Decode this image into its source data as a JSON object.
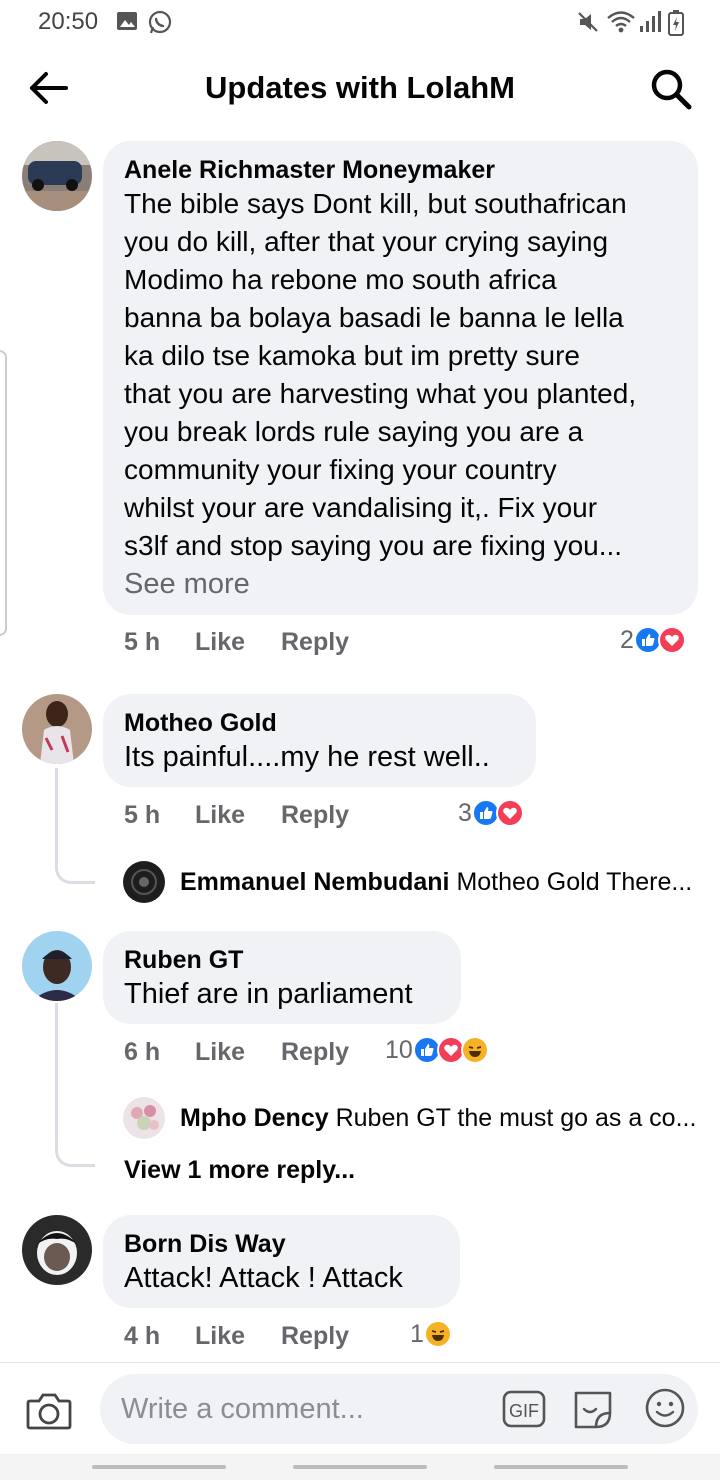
{
  "status_bar": {
    "time": "20:50"
  },
  "header": {
    "title": "Updates with LolahM"
  },
  "comments": [
    {
      "name": "Anele Richmaster Moneymaker",
      "text": "The bible says Dont kill, but southafrican\nyou do kill, after that your crying saying\nModimo ha rebone mo south africa\nbanna ba bolaya basadi le banna  le lella\nka dilo tse kamoka  but  im pretty sure\nthat you are harvesting what you planted,\nyou break lords rule saying you are a\ncommunity your fixing your country\nwhilst your are vandalising it,. Fix your\ns3lf and stop saying you are fixing you...",
      "see_more": "See more",
      "time": "5 h",
      "like": "Like",
      "reply": "Reply",
      "reaction_count": "2"
    },
    {
      "name": "Motheo Gold",
      "text": "Its painful....my he rest well..",
      "time": "5 h",
      "like": "Like",
      "reply": "Reply",
      "reaction_count": "3",
      "reply_preview": {
        "name": "Emmanuel Nembudani",
        "text": "Motheo Gold There..."
      }
    },
    {
      "name": "Ruben GT",
      "text": "Thief are in parliament",
      "time": "6 h",
      "like": "Like",
      "reply": "Reply",
      "reaction_count": "10",
      "reply_preview": {
        "name": "Mpho Dency",
        "text": "Ruben GT the must go as a co..."
      },
      "view_more": "View 1 more reply..."
    },
    {
      "name": "Born Dis Way",
      "text": "Attack! Attack ! Attack",
      "time": "4 h",
      "like": "Like",
      "reply": "Reply",
      "reaction_count": "1"
    }
  ],
  "composer": {
    "placeholder": "Write a comment...",
    "gif_label": "GIF"
  },
  "colors": {
    "like_blue": "#1877f2",
    "love_red": "#f33e58",
    "haha_yellow": "#f7b125",
    "muted_text": "#65676b",
    "bubble_bg": "#f0f2f5"
  },
  "icons": [
    "back-arrow-icon",
    "search-icon",
    "like-icon",
    "love-icon",
    "haha-icon",
    "camera-icon",
    "gif-icon",
    "sticker-icon",
    "emoji-icon"
  ]
}
